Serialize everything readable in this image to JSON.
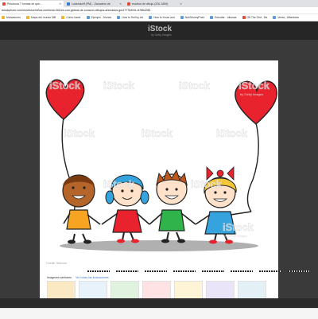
{
  "browser": {
    "tabs": [
      {
        "label": "Pelotonía 7 formas de que...",
        "active": true
      },
      {
        "label": "Ludendorff (PM) - Ganadero de",
        "active": false
      },
      {
        "label": "escritos de dibujo (200-1800)",
        "active": false
      }
    ],
    "url": "istockphoto.com/es/vector/niños-corriendo-felices-con-globos-de-corazon-dibujos-animados-gm477784911-67864285",
    "bookmarks": [
      "Marcadores",
      "Mapa del mundo MB",
      "Cómo hacer",
      "Ejemplo - Mundo",
      "How to Sell by Art",
      "How to Know and",
      "NaVMoneyPoint",
      "Estudiar - Idiomas",
      "Off The Grid - Ba",
      "Venta - Alfombras"
    ]
  },
  "site": {
    "brand": "iStock",
    "brand_sub": "by Getty Images"
  },
  "image": {
    "watermark": "iStock",
    "watermark_sub": "by Getty Images",
    "credit": "Credit: lemono",
    "description": "Four happy cartoon kids holding hands with red heart balloons"
  },
  "related": {
    "label": "Imágenes similares",
    "more_link": "Ver todas las ilustraciones"
  },
  "colors": {
    "heart": "#e8232d",
    "shirt_orange": "#f6a422",
    "shirt_red": "#e8232d",
    "shirt_green": "#2fb34a",
    "shirt_blue": "#35a3de",
    "background_dark": "#3a3a3a"
  }
}
